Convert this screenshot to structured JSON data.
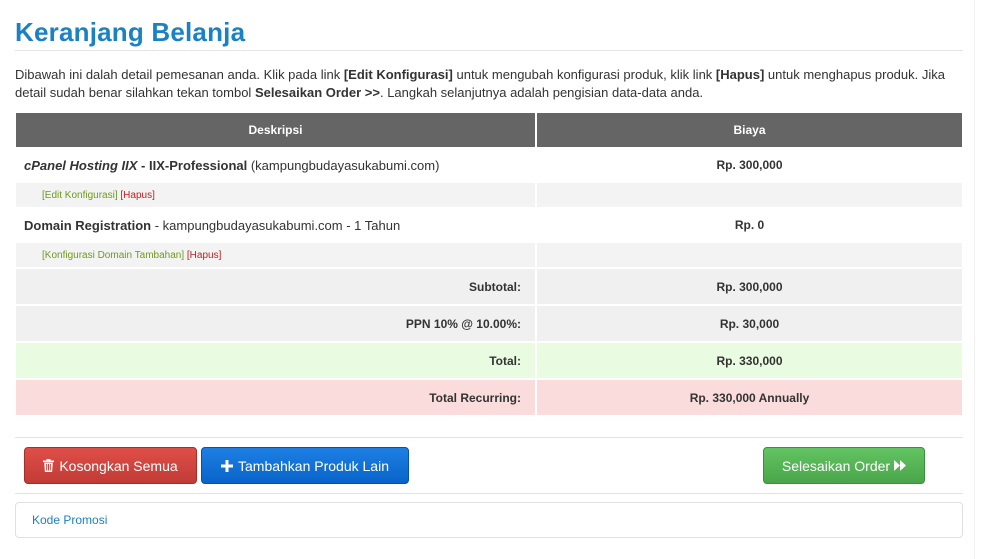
{
  "page": {
    "title": "Keranjang Belanja"
  },
  "intro": {
    "p1": "Dibawah ini dalah detail pemesanan anda. Klik pada link ",
    "edit_label": "[Edit Konfigurasi]",
    "p2": " untuk mengubah konfigurasi produk, klik link ",
    "delete_label": "[Hapus]",
    "p3": " untuk menghapus produk. Jika detail sudah benar silahkan tekan tombol ",
    "checkout_label": "Selesaikan Order >>",
    "p4": ". Langkah selanjutnya adalah pengisian data-data anda."
  },
  "table": {
    "headers": {
      "desc": "Deskripsi",
      "price": "Biaya"
    },
    "items": [
      {
        "group": "cPanel Hosting IIX",
        "separator": " - ",
        "product": "IIX-Professional",
        "detail": " (kampungbudayasukabumi.com)",
        "price": "Rp. 300,000",
        "link_primary": "[Edit Konfigurasi]",
        "link_delete": "[Hapus]"
      },
      {
        "name": "Domain Registration",
        "detail": " - kampungbudayasukabumi.com - 1 Tahun",
        "price": "Rp. 0",
        "link_primary": "[Konfigurasi Domain Tambahan]",
        "link_delete": "[Hapus]"
      }
    ],
    "summary": {
      "subtotal_label": "Subtotal:",
      "subtotal_value": "Rp. 300,000",
      "tax_label": "PPN 10% @ 10.00%:",
      "tax_value": "Rp. 30,000",
      "total_label": "Total:",
      "total_value": "Rp. 330,000",
      "recurring_label": "Total Recurring:",
      "recurring_value": "Rp. 330,000 Annually"
    }
  },
  "actions": {
    "empty_cart": "Kosongkan Semua",
    "add_product": "Tambahkan Produk Lain",
    "checkout": "Selesaikan Order"
  },
  "promo": {
    "link": "Kode Promosi"
  },
  "colors": {
    "title_blue": "#1a82c3",
    "header_grey": "#656565",
    "total_green_bg": "#e9fbe0",
    "recurring_red_bg": "#fbdcdc",
    "danger_button": "#d9534f",
    "primary_button": "#0e6fd6",
    "success_button": "#5cb85c"
  },
  "icons": {
    "empty_cart": "trash-icon",
    "add_product": "plus-icon",
    "checkout": "forward-icon"
  }
}
